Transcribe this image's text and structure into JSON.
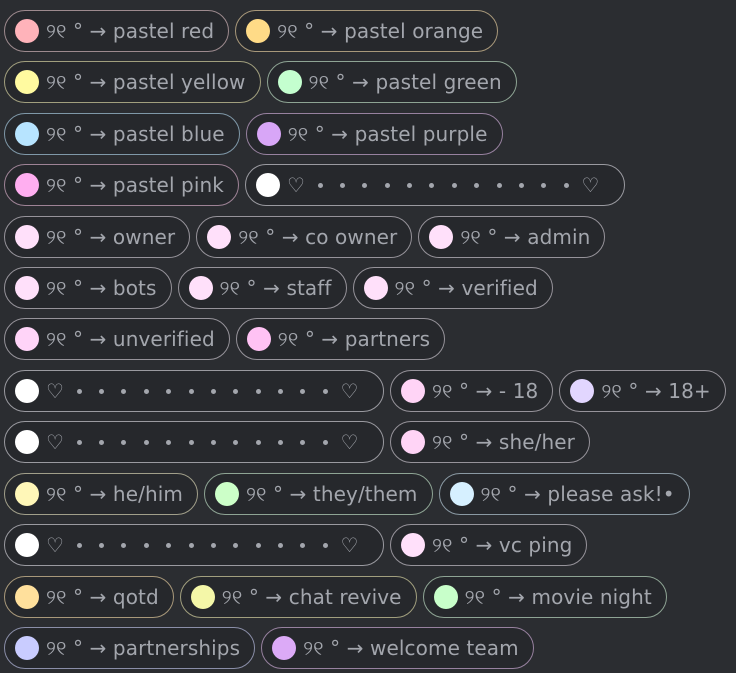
{
  "prefix": "୨୧ ° →",
  "divider": {
    "heart": "♡",
    "dot_count": 12,
    "color": "#ffffff"
  },
  "rows": [
    [
      {
        "type": "role",
        "name": "pastel red",
        "color": "#ffb3ba",
        "border": "#9d8a8e"
      },
      {
        "type": "role",
        "name": "pastel orange",
        "color": "#ffdb87",
        "border": "#a8987a"
      }
    ],
    [
      {
        "type": "role",
        "name": "pastel yellow",
        "color": "#fffaa0",
        "border": "#a19f7e"
      },
      {
        "type": "role",
        "name": "pastel green",
        "color": "#c4ffcf",
        "border": "#8ea494"
      }
    ],
    [
      {
        "type": "role",
        "name": "pastel blue",
        "color": "#b7e4ff",
        "border": "#7f98a8"
      },
      {
        "type": "role",
        "name": "pastel purple",
        "color": "#d8a6f7",
        "border": "#97819f"
      }
    ],
    [
      {
        "type": "role",
        "name": "pastel pink",
        "color": "#ffaef0",
        "border": "#9e8396"
      },
      {
        "type": "divider"
      }
    ],
    [
      {
        "type": "role",
        "name": "owner",
        "color": "#ffe0fa",
        "border": "#96939a"
      },
      {
        "type": "role",
        "name": "co owner",
        "color": "#ffe0fa",
        "border": "#96939a"
      },
      {
        "type": "role",
        "name": "admin",
        "color": "#ffe0fa",
        "border": "#96939a"
      }
    ],
    [
      {
        "type": "role",
        "name": "bots",
        "color": "#ffe0fa",
        "border": "#96939a"
      },
      {
        "type": "role",
        "name": "staff",
        "color": "#ffe0fa",
        "border": "#96939a"
      },
      {
        "type": "role",
        "name": "verified",
        "color": "#ffe0fa",
        "border": "#96939a"
      }
    ],
    [
      {
        "type": "role",
        "name": "unverified",
        "color": "#ffd4f8",
        "border": "#96939a"
      },
      {
        "type": "role",
        "name": "partners",
        "color": "#ffc2f4",
        "border": "#96939a"
      }
    ],
    [
      {
        "type": "divider"
      },
      {
        "type": "role",
        "name": "- 18",
        "color": "#ffd4f6",
        "border": "#96939a"
      },
      {
        "type": "role",
        "name": "18+",
        "color": "#e2d6ff",
        "border": "#96939a"
      }
    ],
    [
      {
        "type": "divider"
      },
      {
        "type": "role",
        "name": "she/her",
        "color": "#ffd4f6",
        "border": "#96939a"
      }
    ],
    [
      {
        "type": "role",
        "name": "he/him",
        "color": "#fff7b8",
        "border": "#a19f8a"
      },
      {
        "type": "role",
        "name": "they/them",
        "color": "#ccffc8",
        "border": "#8ea494"
      },
      {
        "type": "role",
        "name": "please ask!•",
        "color": "#d6f0ff",
        "border": "#8a99a3"
      }
    ],
    [
      {
        "type": "divider"
      },
      {
        "type": "role",
        "name": "vc ping",
        "color": "#ffe0fa",
        "border": "#96939a"
      }
    ],
    [
      {
        "type": "role",
        "name": "qotd",
        "color": "#ffe09c",
        "border": "#a8987a"
      },
      {
        "type": "role",
        "name": "chat revive",
        "color": "#f4f7a8",
        "border": "#a19f7e"
      },
      {
        "type": "role",
        "name": "movie night",
        "color": "#c8ffca",
        "border": "#8ea494"
      }
    ],
    [
      {
        "type": "role",
        "name": "partnerships",
        "color": "#c9ccff",
        "border": "#8a8ea8"
      },
      {
        "type": "role",
        "name": "welcome team",
        "color": "#dcaaf7",
        "border": "#97819f"
      }
    ]
  ]
}
